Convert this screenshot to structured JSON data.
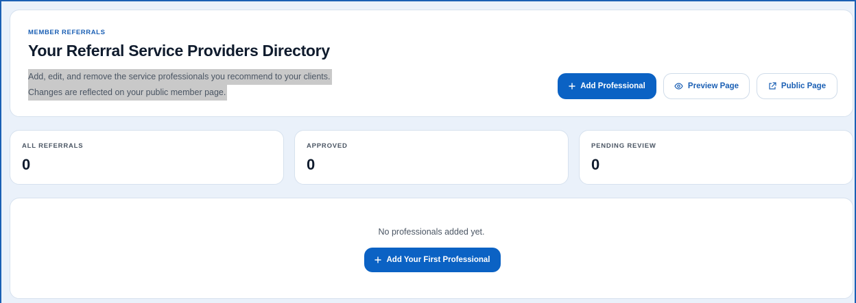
{
  "header": {
    "eyebrow": "MEMBER REFERRALS",
    "title": "Your Referral Service Providers Directory",
    "description_line1": "Add, edit, and remove the service professionals you recommend to your clients.",
    "description_line2": "Changes are reflected on your public member page."
  },
  "actions": {
    "add_label": "Add Professional",
    "add_icon": "plus-icon",
    "preview_label": "Preview Page",
    "preview_icon": "eye-icon",
    "public_label": "Public Page",
    "public_icon": "external-link-icon"
  },
  "stats": [
    {
      "label": "ALL REFERRALS",
      "value": "0"
    },
    {
      "label": "APPROVED",
      "value": "0"
    },
    {
      "label": "PENDING REVIEW",
      "value": "0"
    }
  ],
  "empty_state": {
    "message": "No professionals added yet.",
    "button_label": "Add Your First Professional",
    "button_icon": "plus-icon"
  },
  "colors": {
    "accent": "#0b62c4",
    "background": "#eaf1fa",
    "text_dark": "#0f1b2d",
    "text_muted": "#4a5563"
  }
}
